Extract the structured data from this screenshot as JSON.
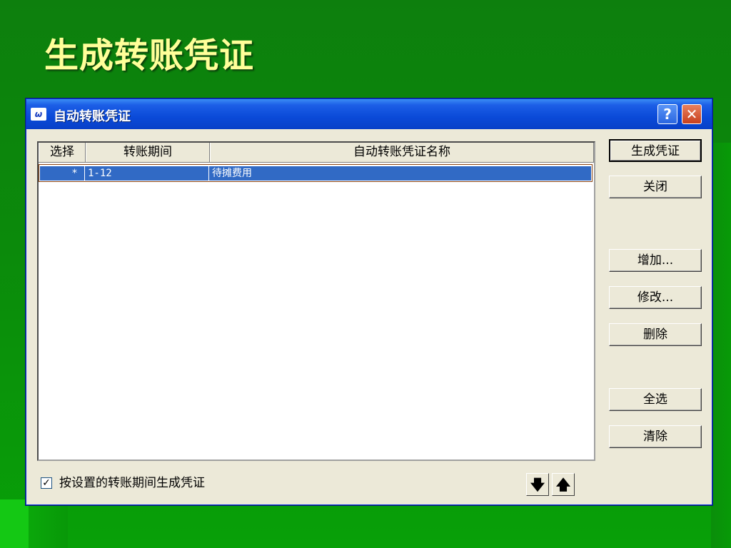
{
  "slide": {
    "title": "生成转账凭证"
  },
  "dialog": {
    "title": "自动转账凭证",
    "icon": "app-logo-icon",
    "help_label": "?",
    "close_label": "✕"
  },
  "table": {
    "columns": [
      "选择",
      "转账期间",
      "自动转账凭证名称"
    ],
    "rows": [
      {
        "select": "*",
        "period": "1-12",
        "name": "待摊费用"
      }
    ]
  },
  "buttons": {
    "generate": "生成凭证",
    "close": "关闭",
    "add": "增加...",
    "modify": "修改...",
    "delete": "删除",
    "select_all": "全选",
    "clear": "清除"
  },
  "checkbox": {
    "checked": true,
    "label": "按设置的转账期间生成凭证"
  },
  "arrows": {
    "down": "🡇",
    "up": "🡅"
  },
  "colors": {
    "selection": "#316ac5",
    "title_text": "#ffff99"
  }
}
